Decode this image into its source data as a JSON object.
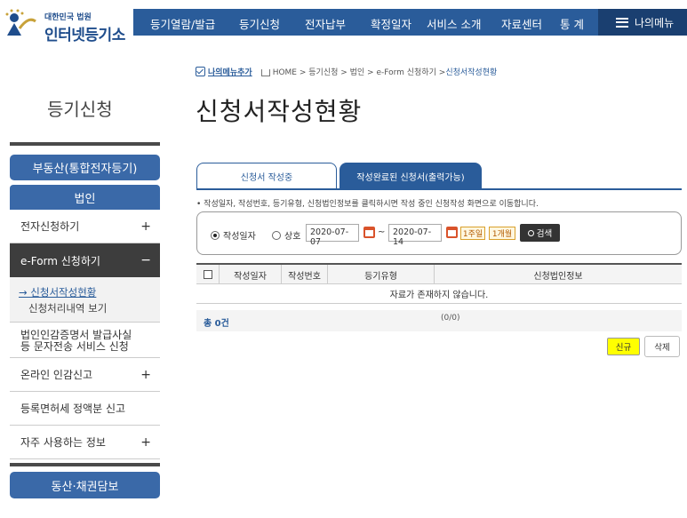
{
  "header": {
    "logo_small": "대한민국 법원",
    "logo_big": "인터넷등기소",
    "menu": [
      "등기열람/발급",
      "등기신청",
      "전자납부",
      "확정일자",
      "서비스 소개",
      "자료센터",
      "통 계"
    ],
    "my_menu": "나의메뉴"
  },
  "sidebar": {
    "title": "등기신청",
    "top_button": "부동산(통합전자등기)",
    "section": "법인",
    "items": [
      {
        "label": "전자신청하기",
        "sign": "+"
      },
      {
        "label": "e-Form 신청하기",
        "sign": "−"
      }
    ],
    "subitems": [
      "→ 신청서작성현황",
      "신청처리내역 보기"
    ],
    "items2": [
      {
        "label": "법인인감증명서 발급사실 등 문자전송 서비스 신청",
        "sign": ""
      },
      {
        "label": "온라인 인감신고",
        "sign": "+"
      },
      {
        "label": "등록면허세 정액분 신고",
        "sign": ""
      },
      {
        "label": "자주 사용하는 정보",
        "sign": "+"
      }
    ],
    "bottom_button": "동산·채권담보"
  },
  "breadcrumb": {
    "my_menu_add": "나의메뉴추가",
    "path": "HOME > 등기신청 > 법인 > e-Form 신청하기 > ",
    "current": "신청서작성현황"
  },
  "page_title": "신청서작성현황",
  "tabs": [
    "신청서 작성중",
    "작성완료된 신청서(출력가능)"
  ],
  "note": "• 작성일자, 작성번호, 등기유형, 신청법인정보를 클릭하시면 작성 중인 신청작성 화면으로 이동합니다.",
  "search": {
    "radio1": "작성일자",
    "radio2": "상호",
    "date_from": "2020-07-07",
    "tilde": "~",
    "date_to": "2020-07-14",
    "period1": "1주일",
    "period2": "1개월",
    "button": "검색"
  },
  "table": {
    "headers": [
      "작성일자",
      "작성번호",
      "등기유형",
      "신청법인정보"
    ],
    "empty": "자료가 존재하지 않습니다."
  },
  "total": "총 0건",
  "pager": "(0/0)",
  "buttons": {
    "new": "신규",
    "delete": "삭제"
  },
  "colors": {
    "primary": "#2a5c9a",
    "highlight": "#ffff00"
  }
}
